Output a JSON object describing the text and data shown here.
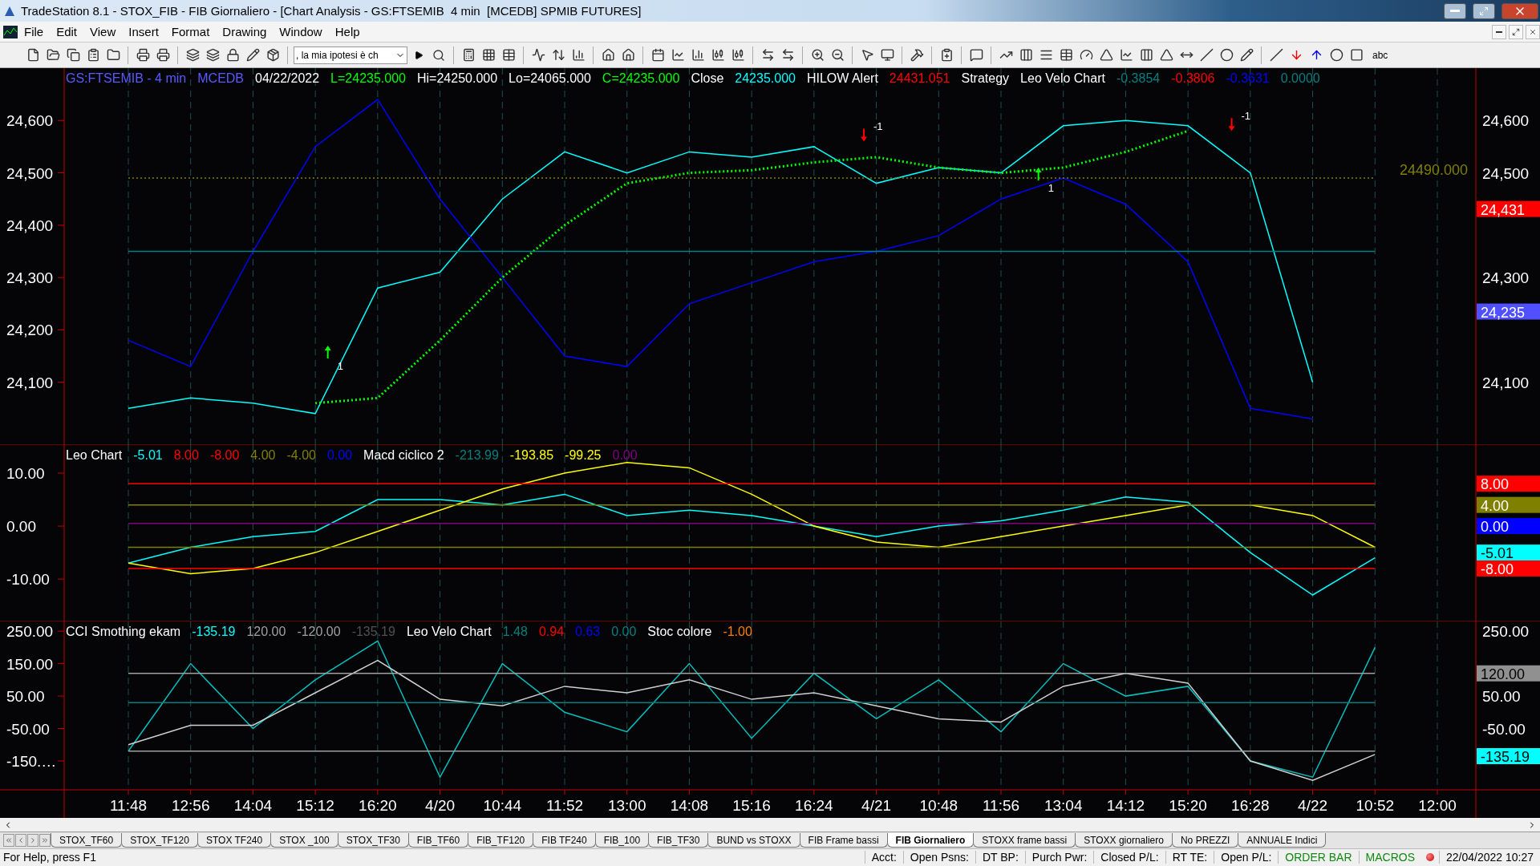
{
  "window": {
    "title": "TradeStation 8.1 - STOX_FIB - FIB Giornaliero - [Chart Analysis - GS:FTSEMIB  4 min  [MCEDB] SPMIB FUTURES]"
  },
  "menu": [
    "File",
    "Edit",
    "View",
    "Insert",
    "Format",
    "Drawing",
    "Window",
    "Help"
  ],
  "toolbar": {
    "dropdown": {
      "value": ", la mia ipotesi è ch"
    },
    "text_tool": "abc"
  },
  "panels": [
    {
      "legend": [
        {
          "text": "GS:FTSEMIB - 4 min",
          "color": "#5a5aff"
        },
        {
          "text": "MCEDB",
          "color": "#5a5aff"
        },
        {
          "text": "04/22/2022",
          "color": "#ffffff"
        },
        {
          "text": "L=24235.000",
          "color": "#00ff00"
        },
        {
          "text": "Hi=24250.000",
          "color": "#ffffff"
        },
        {
          "text": "Lo=24065.000",
          "color": "#ffffff"
        },
        {
          "text": "C=24235.000",
          "color": "#00ff00"
        },
        {
          "text": "Close",
          "color": "#ffffff"
        },
        {
          "text": "24235.000",
          "color": "#00ffff"
        },
        {
          "text": "HILOW Alert",
          "color": "#ffffff"
        },
        {
          "text": "24431.051",
          "color": "#ff0000"
        },
        {
          "text": "Strategy",
          "color": "#ffffff"
        },
        {
          "text": "Leo Velo Chart",
          "color": "#ffffff"
        },
        {
          "text": "-0.3854",
          "color": "#008080"
        },
        {
          "text": "-0.3806",
          "color": "#ff0000"
        },
        {
          "text": "-0.3631",
          "color": "#0000ff"
        },
        {
          "text": "0.0000",
          "color": "#008080"
        }
      ],
      "line_label": "24490.000",
      "badges": [
        {
          "text": "24,431",
          "color": "#ff0000"
        },
        {
          "text": "24,235",
          "color": "#5050ff"
        }
      ],
      "signals": [
        {
          "text": "1",
          "kind": "buy"
        },
        {
          "text": "-1",
          "kind": "sell"
        },
        {
          "text": "1",
          "kind": "buy"
        },
        {
          "text": "-1",
          "kind": "sell"
        }
      ],
      "chart_data": {
        "type": "line",
        "grid": true,
        "ylim": [
          23980,
          24700
        ],
        "yticks": [
          {
            "value": 24600,
            "label": "24,600"
          },
          {
            "value": 24500,
            "label": "24,500"
          },
          {
            "value": 24400,
            "label": "24,400"
          },
          {
            "value": 24300,
            "label": "24,300"
          },
          {
            "value": 24200,
            "label": "24,200"
          },
          {
            "value": 24100,
            "label": "24,100"
          }
        ],
        "series": [
          {
            "color": "#00ffff",
            "values": [
              24050,
              24070,
              24060,
              24040,
              24280,
              24310,
              24450,
              24540,
              24500,
              24540,
              24530,
              24550,
              24480,
              24510,
              24500,
              24590,
              24600,
              24590,
              24500,
              24100,
              null,
              null
            ]
          },
          {
            "color": "#0000ff",
            "values": [
              24180,
              24130,
              24350,
              24550,
              24640,
              24450,
              24300,
              24150,
              24130,
              24250,
              24290,
              24330,
              24350,
              24380,
              24450,
              24490,
              24440,
              24330,
              24050,
              24030,
              null,
              null
            ]
          },
          {
            "color": "#00ff00",
            "line_style": "dotted",
            "values": [
              null,
              null,
              null,
              24060,
              24070,
              24180,
              24300,
              24400,
              24480,
              24500,
              24505,
              24520,
              24530,
              24510,
              24500,
              24510,
              24540,
              24580,
              null,
              null,
              null,
              null
            ]
          },
          {
            "color": "#008080",
            "values": [
              24350,
              24350,
              24350,
              24350,
              24350,
              24350,
              24350,
              24350,
              24350,
              24350,
              24350,
              24350,
              24350,
              24350,
              24350,
              24350,
              24350,
              24350,
              24350,
              24350,
              24350,
              null
            ]
          },
          {
            "color": "#808000",
            "line_style": "dotted",
            "values": [
              24490,
              24490,
              24490,
              24490,
              24490,
              24490,
              24490,
              24490,
              24490,
              24490,
              24490,
              24490,
              24490,
              24490,
              24490,
              24490,
              24490,
              24490,
              24490,
              24490,
              24490,
              null
            ]
          }
        ]
      }
    },
    {
      "legend": [
        {
          "text": "Leo Chart",
          "color": "#ffffff"
        },
        {
          "text": "-5.01",
          "color": "#00ffff"
        },
        {
          "text": "8.00",
          "color": "#ff0000"
        },
        {
          "text": "-8.00",
          "color": "#ff0000"
        },
        {
          "text": "4.00",
          "color": "#808000"
        },
        {
          "text": "-4.00",
          "color": "#808000"
        },
        {
          "text": "0.00",
          "color": "#0000ff"
        },
        {
          "text": "Macd ciclico 2",
          "color": "#ffffff"
        },
        {
          "text": "-213.99",
          "color": "#008080"
        },
        {
          "text": "-193.85",
          "color": "#ffff00"
        },
        {
          "text": "-99.25",
          "color": "#ffff00"
        },
        {
          "text": "0.00",
          "color": "#800080"
        }
      ],
      "badges": [
        {
          "text": "8.00",
          "color": "#ff0000"
        },
        {
          "text": "4.00",
          "color": "#808000"
        },
        {
          "text": "0.00",
          "color": "#0000ff"
        },
        {
          "text": "-5.01",
          "color": "#00ffff"
        },
        {
          "text": "-8.00",
          "color": "#ff0000"
        }
      ],
      "chart_data": {
        "type": "line",
        "grid": true,
        "ylim": [
          -18,
          15.3
        ],
        "yticks": [
          {
            "value": 10,
            "label": "10.00"
          },
          {
            "value": 0,
            "label": "0.00"
          },
          {
            "value": -10,
            "label": "-10.00"
          }
        ],
        "series": [
          {
            "color": "#00ffff",
            "values": [
              -7,
              -4,
              -2,
              -1,
              5,
              5,
              4,
              6,
              2,
              3,
              2,
              0,
              -2,
              0,
              1,
              3,
              5.5,
              4.5,
              -5,
              -13,
              -6,
              null
            ]
          },
          {
            "color": "#ffff00",
            "values": [
              -7,
              -9,
              -8,
              -5,
              -1,
              3,
              7,
              10,
              12,
              11,
              6,
              0,
              -3,
              -4,
              -2,
              0,
              2,
              4,
              4,
              2,
              -4,
              null
            ]
          },
          {
            "color": "#ff0000",
            "values": [
              8,
              8,
              8,
              8,
              8,
              8,
              8,
              8,
              8,
              8,
              8,
              8,
              8,
              8,
              8,
              8,
              8,
              8,
              8,
              8,
              8,
              null
            ]
          },
          {
            "color": "#808000",
            "values": [
              4,
              4,
              4,
              4,
              4,
              4,
              4,
              4,
              4,
              4,
              4,
              4,
              4,
              4,
              4,
              4,
              4,
              4,
              4,
              4,
              4,
              null
            ]
          },
          {
            "color": "#800080",
            "values": [
              0.5,
              0.5,
              0.5,
              0.5,
              0.5,
              0.5,
              0.5,
              0.5,
              0.5,
              0.5,
              0.5,
              0.5,
              0.5,
              0.5,
              0.5,
              0.5,
              0.5,
              0.5,
              0.5,
              0.5,
              0.5,
              null
            ]
          },
          {
            "color": "#808000",
            "values": [
              -4,
              -4,
              -4,
              -4,
              -4,
              -4,
              -4,
              -4,
              -4,
              -4,
              -4,
              -4,
              -4,
              -4,
              -4,
              -4,
              -4,
              -4,
              -4,
              -4,
              -4,
              null
            ]
          },
          {
            "color": "#ff0000",
            "values": [
              -8,
              -8,
              -8,
              -8,
              -8,
              -8,
              -8,
              -8,
              -8,
              -8,
              -8,
              -8,
              -8,
              -8,
              -8,
              -8,
              -8,
              -8,
              -8,
              -8,
              -8,
              null
            ]
          }
        ]
      }
    },
    {
      "legend": [
        {
          "text": "CCI Smothing ekam",
          "color": "#ffffff"
        },
        {
          "text": "-135.19",
          "color": "#00ffff"
        },
        {
          "text": "120.00",
          "color": "#a0a0a0"
        },
        {
          "text": "-120.00",
          "color": "#a0a0a0"
        },
        {
          "text": "-135.19",
          "color": "#505050"
        },
        {
          "text": "Leo Velo Chart",
          "color": "#ffffff"
        },
        {
          "text": "1.48",
          "color": "#008080"
        },
        {
          "text": "0.94",
          "color": "#ff0000"
        },
        {
          "text": "0.63",
          "color": "#0000ff"
        },
        {
          "text": "0.00",
          "color": "#008080"
        },
        {
          "text": "Stoc colore",
          "color": "#ffffff"
        },
        {
          "text": "-1.00",
          "color": "#ff8000"
        }
      ],
      "badges": [
        {
          "text": "120.00",
          "color": "#909090"
        },
        {
          "text": "-135.19",
          "color": "#00ffff"
        }
      ],
      "chart_data": {
        "type": "line",
        "grid": true,
        "ylim": [
          -239,
          280
        ],
        "categories": [
          "11:48",
          "12:56",
          "14:04",
          "15:12",
          "16:20",
          "4/20",
          "10:44",
          "11:52",
          "13:00",
          "14:08",
          "15:16",
          "16:24",
          "4/21",
          "10:48",
          "11:56",
          "13:04",
          "14:12",
          "15:20",
          "16:28",
          "4/22",
          "10:52",
          "12:00"
        ],
        "yticks": [
          {
            "value": 250,
            "label": "250.00"
          },
          {
            "value": 150,
            "label": "150.00"
          },
          {
            "value": 50,
            "label": "50.00"
          },
          {
            "value": -50,
            "label": "-50.00"
          },
          {
            "value": -150,
            "label": "-150.…"
          }
        ],
        "series": [
          {
            "color": "#00c0c0",
            "values": [
              -120,
              150,
              -50,
              100,
              220,
              -200,
              150,
              0,
              -60,
              150,
              -80,
              120,
              -20,
              100,
              -60,
              150,
              50,
              80,
              -150,
              -200,
              200,
              null
            ]
          },
          {
            "color": "#d0d0d0",
            "values": [
              -100,
              -40,
              -40,
              60,
              160,
              40,
              20,
              80,
              60,
              100,
              40,
              60,
              20,
              -20,
              -30,
              80,
              120,
              90,
              -150,
              -210,
              -130,
              null
            ]
          },
          {
            "color": "#a0a0a0",
            "values": [
              120,
              120,
              120,
              120,
              120,
              120,
              120,
              120,
              120,
              120,
              120,
              120,
              120,
              120,
              120,
              120,
              120,
              120,
              120,
              120,
              120,
              null
            ]
          },
          {
            "color": "#008080",
            "values": [
              30,
              30,
              30,
              30,
              30,
              30,
              30,
              30,
              30,
              30,
              30,
              30,
              30,
              30,
              30,
              30,
              30,
              30,
              30,
              30,
              30,
              null
            ]
          },
          {
            "color": "#a0a0a0",
            "values": [
              -120,
              -120,
              -120,
              -120,
              -120,
              -120,
              -120,
              -120,
              -120,
              -120,
              -120,
              -120,
              -120,
              -120,
              -120,
              -120,
              -120,
              -120,
              -120,
              -120,
              -120,
              null
            ]
          }
        ]
      }
    }
  ],
  "sheet_tabs": [
    {
      "label": "STOX_TF60",
      "selected": false
    },
    {
      "label": "STOX_TF120",
      "selected": false
    },
    {
      "label": "STOX TF240",
      "selected": false
    },
    {
      "label": "STOX _100",
      "selected": false
    },
    {
      "label": "STOX_TF30",
      "selected": false
    },
    {
      "label": "FIB_TF60",
      "selected": false
    },
    {
      "label": "FIB_TF120",
      "selected": false
    },
    {
      "label": "FIB TF240",
      "selected": false
    },
    {
      "label": "FIB_100",
      "selected": false
    },
    {
      "label": "FIB_TF30",
      "selected": false
    },
    {
      "label": "BUND vs STOXX",
      "selected": false
    },
    {
      "label": "FIB Frame bassi",
      "selected": false
    },
    {
      "label": "FIB Giornaliero",
      "selected": true
    },
    {
      "label": "STOXX frame bassi",
      "selected": false
    },
    {
      "label": "STOXX giornaliero",
      "selected": false
    },
    {
      "label": "No PREZZI",
      "selected": false
    },
    {
      "label": "ANNUALE Indici",
      "selected": false
    }
  ],
  "status_bar": {
    "help": "For Help, press F1",
    "fields": [
      {
        "text": "Acct:",
        "color": "#000000"
      },
      {
        "text": "Open Psns:",
        "color": "#000000"
      },
      {
        "text": "DT BP:",
        "color": "#000000"
      },
      {
        "text": "Purch Pwr:",
        "color": "#000000"
      },
      {
        "text": "Closed P/L:",
        "color": "#000000"
      },
      {
        "text": "RT TE:",
        "color": "#000000"
      },
      {
        "text": "Open P/L:",
        "color": "#000000"
      },
      {
        "text": "ORDER BAR",
        "color": "#118811"
      },
      {
        "text": "MACROS",
        "color": "#118811"
      }
    ],
    "datetime": "22/04/2022 10:27"
  }
}
